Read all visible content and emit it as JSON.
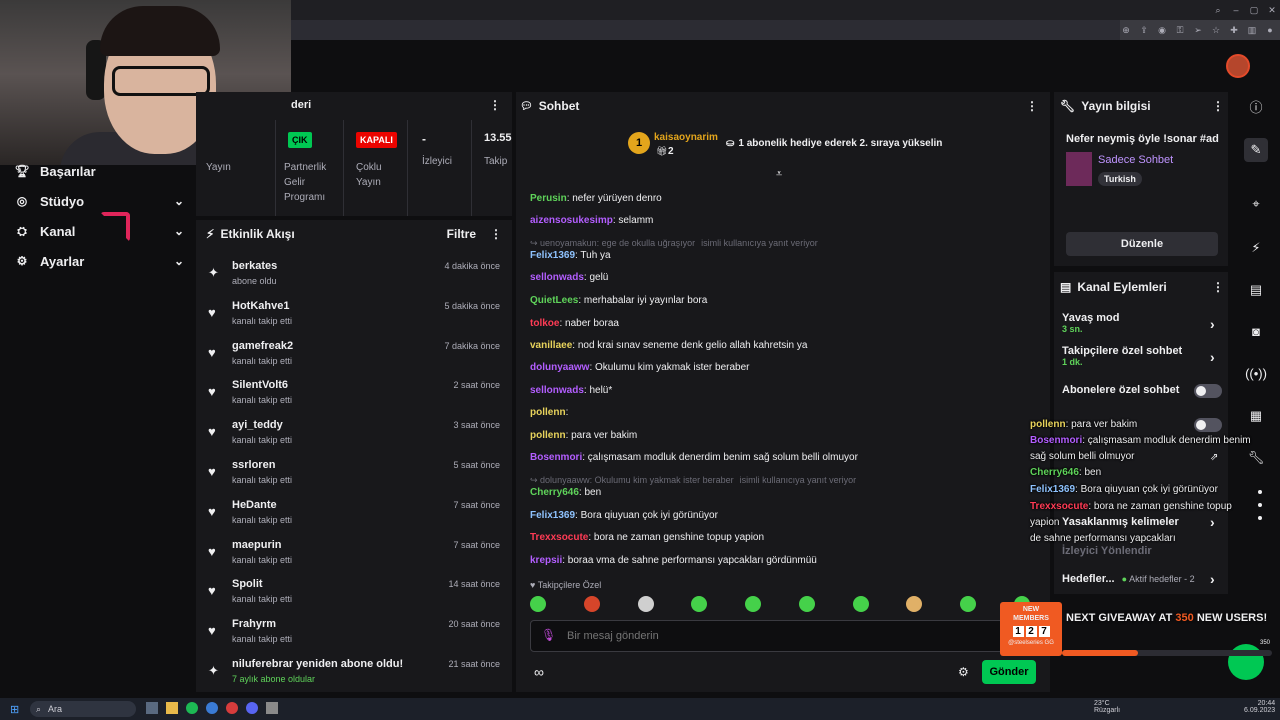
{
  "sidebar": {
    "items": [
      {
        "label": "Başarılar",
        "icon": "trophy-icon",
        "expandable": false
      },
      {
        "label": "Stüdyo",
        "icon": "studio-icon",
        "expandable": true
      },
      {
        "label": "Kanal",
        "icon": "channel-icon",
        "expandable": true
      },
      {
        "label": "Ayarlar",
        "icon": "gear-icon",
        "expandable": true
      }
    ]
  },
  "stats": {
    "header": "deri",
    "cells": [
      {
        "badge": "ÇIK",
        "badge_color": "#00c853",
        "label": "Yayın"
      },
      {
        "badge": "",
        "label": "Partnerlik Gelir Programı"
      },
      {
        "badge": "KAPALI",
        "badge_color": "#eb0400",
        "label": "Çoklu Yayın"
      },
      {
        "value": "-",
        "label": "İzleyici"
      },
      {
        "value": "13.55",
        "label": "Takip"
      }
    ]
  },
  "activity": {
    "title": "Etkinlik Akışı",
    "filter_label": "Filtre",
    "items": [
      {
        "name": "berkates",
        "sub": "abone oldu",
        "time": "4 dakika önce",
        "icon": "star-icon"
      },
      {
        "name": "HotKahve1",
        "sub": "kanalı takip etti",
        "time": "5 dakika önce",
        "icon": "heart-icon"
      },
      {
        "name": "gamefreak2",
        "sub": "kanalı takip etti",
        "time": "7 dakika önce",
        "icon": "heart-icon"
      },
      {
        "name": "SilentVolt6",
        "sub": "kanalı takip etti",
        "time": "2 saat önce",
        "icon": "heart-icon"
      },
      {
        "name": "ayi_teddy",
        "sub": "kanalı takip etti",
        "time": "3 saat önce",
        "icon": "heart-icon"
      },
      {
        "name": "ssrloren",
        "sub": "kanalı takip etti",
        "time": "5 saat önce",
        "icon": "heart-icon"
      },
      {
        "name": "HeDante",
        "sub": "kanalı takip etti",
        "time": "7 saat önce",
        "icon": "heart-icon"
      },
      {
        "name": "maepurin",
        "sub": "kanalı takip etti",
        "time": "7 saat önce",
        "icon": "heart-icon"
      },
      {
        "name": "Spolit",
        "sub": "kanalı takip etti",
        "time": "14 saat önce",
        "icon": "heart-icon"
      },
      {
        "name": "Frahyrm",
        "sub": "kanalı takip etti",
        "time": "20 saat önce",
        "icon": "heart-icon"
      },
      {
        "name": "niluferebrar yeniden abone oldu!",
        "sub": "7 aylık abone oldular",
        "time": "21 saat önce",
        "icon": "star-icon"
      }
    ]
  },
  "chat": {
    "title": "Sohbet",
    "pinned_user": "kaisaoynarim",
    "pinned_count": "2",
    "pinned_rank": "1",
    "pinned_text": "1 abonelik hediye ederek 2. sıraya yükselin",
    "messages": [
      {
        "user": "Perusin",
        "color": "#5fd35a",
        "text": ": nefer yürüyen denro"
      },
      {
        "user": "aizensosukesimp",
        "color": "#b35eff",
        "text": ": selamm"
      },
      {
        "reply": "uenoyamakun: ege de okulla uğraşıyor",
        "reply_tail": "isimli kullanıcıya yanıt veriyor"
      },
      {
        "user": "Felix1369",
        "color": "#8fc3ff",
        "text": ": Tuh ya"
      },
      {
        "user": "sellonwads",
        "color": "#b35eff",
        "text": ": gelü"
      },
      {
        "user": "QuietLees",
        "color": "#5fd35a",
        "text": ": merhabalar iyi yayınlar bora"
      },
      {
        "user": "tolkoe",
        "color": "#ff3b55",
        "text": ": naber boraa"
      },
      {
        "user": "vanillaee",
        "color": "#e8d35c",
        "text": ": nod krai sınav seneme denk gelio allah kahretsin ya"
      },
      {
        "user": "dolunyaaww",
        "color": "#b35eff",
        "text": ": Okulumu kim yakmak ister beraber"
      },
      {
        "user": "sellonwads",
        "color": "#b35eff",
        "text": ": helü*"
      },
      {
        "user": "pollenn",
        "color": "#e8d35c",
        "text": ":"
      },
      {
        "user": "pollenn",
        "color": "#e8d35c",
        "text": ": para ver bakim"
      },
      {
        "user": "Bosenmori",
        "color": "#b35eff",
        "text": ": çalışmasam modluk denerdim benim sağ solum belli olmuyor"
      },
      {
        "reply": "dolunyaaww: Okulumu kim yakmak ister beraber",
        "reply_tail": "isimli kullanıcıya yanıt veriyor"
      },
      {
        "user": "Cherry646",
        "color": "#5fd35a",
        "text": ": ben"
      },
      {
        "user": "Felix1369",
        "color": "#8fc3ff",
        "text": ": Bora qiuyuan çok iyi görünüyor"
      },
      {
        "user": "Trexxsocute",
        "color": "#ff3b55",
        "text": ": bora ne zaman genshine topup yapion"
      },
      {
        "user": "krepsii",
        "color": "#b35eff",
        "text": ": boraa vma de sahne performansı yapcakları gördünmüü"
      }
    ],
    "followers_only": "Takipçilere Özel",
    "input_placeholder": "Bir mesaj gönderin",
    "send_label": "Gönder"
  },
  "stream_info": {
    "title": "Yayın bilgisi",
    "stream_title": "Nefer neymiş öyle !sonar #ad",
    "category": "Sadece Sohbet",
    "tag": "Turkish",
    "edit_label": "Düzenle"
  },
  "channel_actions": {
    "title": "Kanal Eylemleri",
    "rows": [
      {
        "label": "Yavaş mod",
        "sub": "3 sn."
      },
      {
        "label": "Takipçilere özel sohbet",
        "sub": "1 dk."
      },
      {
        "label": "Abonelere özel sohbet",
        "sub": ""
      },
      {
        "label": "Yasaklanmış kelimeler",
        "sub": ""
      },
      {
        "label": "İzleyici Yönlendir",
        "sub": ""
      },
      {
        "label": "Hedefler...",
        "sub": "Aktif hedefler - 2"
      }
    ]
  },
  "overlay": {
    "lines": [
      {
        "user": "pollenn",
        "color": "#e8d35c",
        "text": ": para ver bakim"
      },
      {
        "user": "Bosenmori",
        "color": "#b35eff",
        "text": ": çalışmasam modluk denerdim benim"
      },
      {
        "user": "",
        "color": "#ffffff",
        "text": "sağ solum belli olmuyor"
      },
      {
        "user": "Cherry646",
        "color": "#5fd35a",
        "text": ": ben"
      },
      {
        "user": "Felix1369",
        "color": "#8fc3ff",
        "text": ": Bora qiuyuan çok iyi görünüyor"
      },
      {
        "user": "Trexxsocute",
        "color": "#ff3b55",
        "text": ": bora ne zaman genshine topup"
      },
      {
        "user": "",
        "color": "#ffffff",
        "text": "yapion"
      },
      {
        "user": "",
        "color": "#ffffff",
        "text": "de sahne performansı yapcakları"
      }
    ],
    "new_members_label": "NEW MEMBERS",
    "new_members_digits": [
      "1",
      "2",
      "7"
    ],
    "sponsor": "@steelseries GG",
    "giveaway_prefix": "NEXT GIVEAWAY AT ",
    "giveaway_number": "350",
    "giveaway_suffix": " NEW USERS!",
    "progress_end": "350",
    "progress_fraction": 0.36
  },
  "taskbar": {
    "search_label": "Ara",
    "weather": "23°C",
    "weather_sub": "Rüzgarlı",
    "time": "20:44",
    "date": "6.09.2023"
  },
  "colors": {
    "accent": "#9147ff",
    "panel": "#18181b",
    "send": "#00c853"
  }
}
